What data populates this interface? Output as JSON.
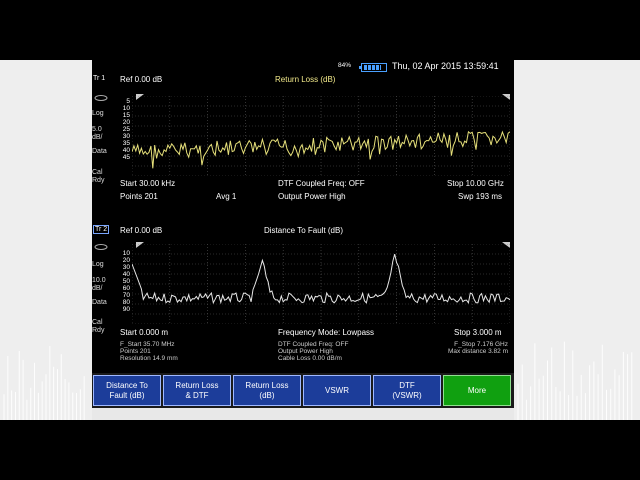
{
  "status": {
    "battery_percent_label": "84%",
    "battery_level": 0.84,
    "datetime": "Thu, 02 Apr 2015 13:59:41"
  },
  "trace1": {
    "trace_label": "Tr 1",
    "ref": "Ref 0.00 dB",
    "title": "Return Loss (dB)",
    "y_ticks": [
      "5",
      "10",
      "15",
      "20",
      "25",
      "30",
      "35",
      "40",
      "45"
    ],
    "side_labels": [
      "Log",
      "5.0",
      "dB/",
      "Data",
      "Cal",
      "Rdy"
    ],
    "info_row1": {
      "left": "Start 30.00 kHz",
      "center": "DTF Coupled Freq: OFF",
      "right": "Stop 10.00 GHz"
    },
    "info_row2": {
      "left": "Points 201",
      "avg": "Avg 1",
      "center": "Output Power High",
      "right": "Swp 193 ms"
    }
  },
  "trace2": {
    "trace_label": "Tr 2",
    "ref": "Ref 0.00 dB",
    "title": "Distance To Fault (dB)",
    "y_ticks": [
      "10",
      "20",
      "30",
      "40",
      "50",
      "60",
      "70",
      "80",
      "90"
    ],
    "side_labels": [
      "Log",
      "10.0",
      "dB/",
      "Data",
      "Cal",
      "Rdy"
    ],
    "info_row1": {
      "left": "Start 0.000 m",
      "center": "Frequency Mode: Lowpass",
      "right": "Stop 3.000 m"
    },
    "details_left": [
      "F_Start 35.70 MHz",
      "Points 201",
      "Resolution 14.9 mm"
    ],
    "details_center": [
      "DTF Coupled Freq: OFF",
      "Output Power High",
      "Cable Loss 0.00 dB/m"
    ],
    "details_right": [
      "F_Stop 7.176 GHz",
      "",
      "Max distance 3.82 m"
    ]
  },
  "softkeys": [
    {
      "line1": "Distance To",
      "line2": "Fault (dB)"
    },
    {
      "line1": "Return Loss",
      "line2": "& DTF"
    },
    {
      "line1": "Return Loss",
      "line2": "(dB)"
    },
    {
      "line1": "VSWR",
      "line2": ""
    },
    {
      "line1": "DTF",
      "line2": "(VSWR)"
    },
    {
      "line1": "More",
      "line2": ""
    }
  ],
  "colors": {
    "trace1": "#e6e07a",
    "trace2": "#e8e8e8",
    "softkey_blue": "#1c3d9a",
    "softkey_green": "#10a010",
    "grid": "#555555"
  }
}
